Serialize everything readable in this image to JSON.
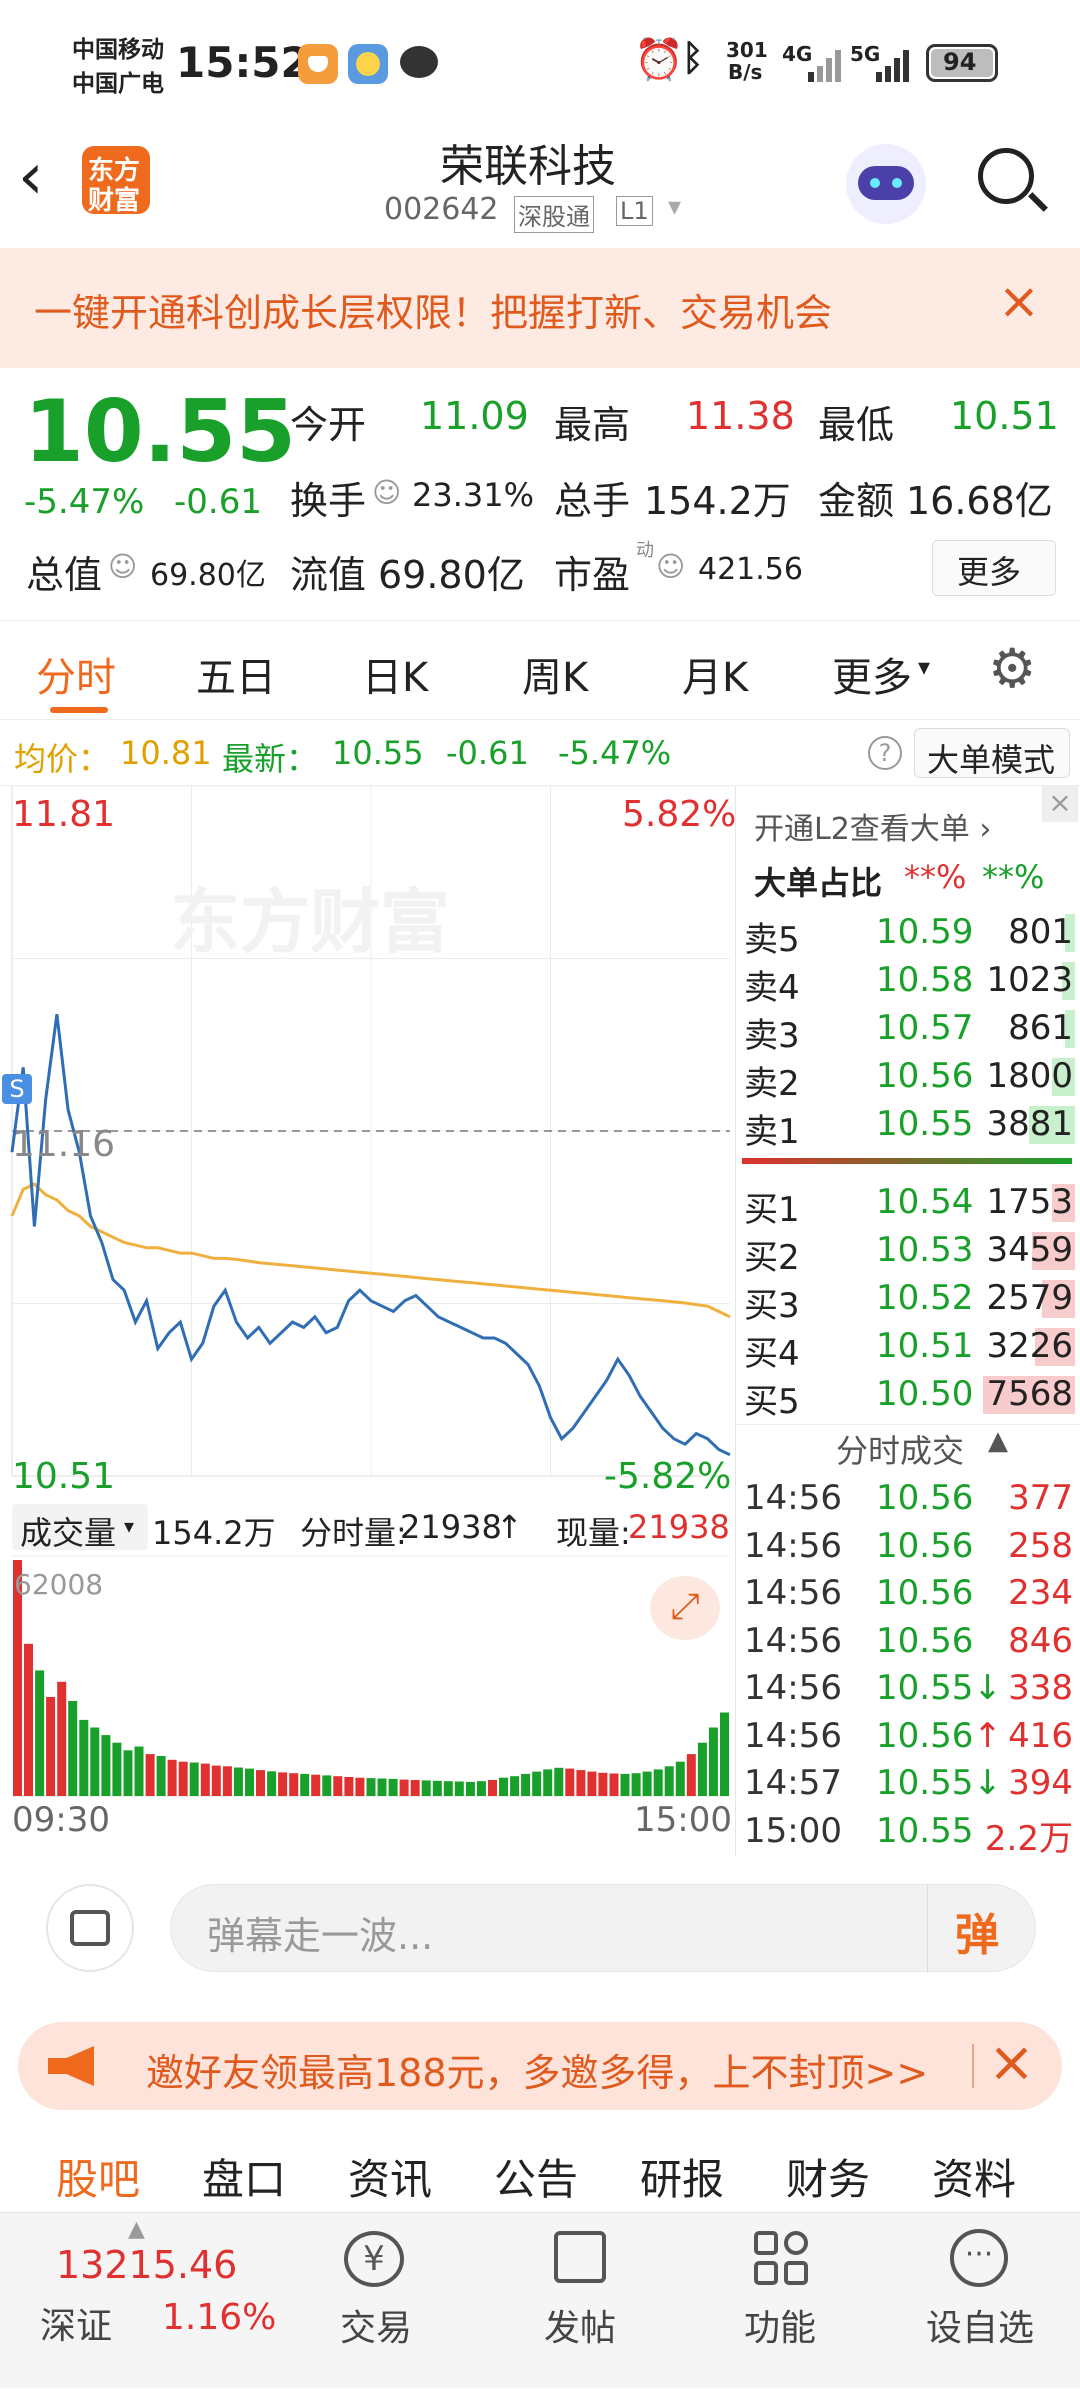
{
  "status": {
    "carrier1": "中国移动",
    "carrier2": "中国广电",
    "time": "15:52",
    "net_speed_top": "301",
    "net_speed_bot": "B/s",
    "net1": "4G",
    "net2": "5G",
    "battery": "94"
  },
  "nav": {
    "logo_top": "东方",
    "logo_bottom": "财富",
    "title": "荣联科技",
    "code": "002642",
    "tag1": "深股通",
    "tag2": "L1"
  },
  "banner": {
    "text": "一键开通科创成长层权限！把握打新、交易机会"
  },
  "quote": {
    "price": "10.55",
    "pct": "-5.47%",
    "chg": "-0.61",
    "open_label": "今开",
    "open": "11.09",
    "high_label": "最高",
    "high": "11.38",
    "low_label": "最低",
    "low": "10.51",
    "turnover_label": "换手",
    "turnover": "23.31%",
    "vol_label": "总手",
    "vol": "154.2万",
    "amt_label": "金额",
    "amt": "16.68亿",
    "mcap_label": "总值",
    "mcap": "69.80亿",
    "fmcap_label": "流值",
    "fmcap": "69.80亿",
    "pe_label": "市盈",
    "pe_sup": "动",
    "pe": "421.56",
    "more": "更多"
  },
  "tabs": [
    "分时",
    "五日",
    "日K",
    "周K",
    "月K",
    "更多"
  ],
  "info": {
    "avg_label": "均价：",
    "avg": "10.81",
    "last_label": "最新：",
    "last": "10.55",
    "chg": "-0.61",
    "pct": "-5.47%",
    "mode": "大单模式"
  },
  "chart": {
    "ymax": "11.81",
    "ymax_pct": "5.82%",
    "ymid": "11.16",
    "ymin": "10.51",
    "ymin_pct": "-5.82%",
    "badge": "S",
    "watermark": "东方财富",
    "vol_label": "成交量",
    "vol_total": "154.2万",
    "vol_min_label": "分时量:",
    "vol_min": "21938",
    "cur_label": "现量:",
    "cur": "21938",
    "vol_max": "62008",
    "t_start": "09:30",
    "t_end": "15:00"
  },
  "book": {
    "l2": "开通L2查看大单",
    "ratio_label": "大单占比",
    "ratio_red": "**%",
    "ratio_green": "**%",
    "asks": [
      {
        "label": "卖5",
        "price": "10.59",
        "vol": "801",
        "w": 0.03
      },
      {
        "label": "卖4",
        "price": "10.58",
        "vol": "1023",
        "w": 0.04
      },
      {
        "label": "卖3",
        "price": "10.57",
        "vol": "861",
        "w": 0.03
      },
      {
        "label": "卖2",
        "price": "10.56",
        "vol": "1800",
        "w": 0.07
      },
      {
        "label": "卖1",
        "price": "10.55",
        "vol": "3881",
        "w": 0.14
      }
    ],
    "bids": [
      {
        "label": "买1",
        "price": "10.54",
        "vol": "1753",
        "w": 0.07
      },
      {
        "label": "买2",
        "price": "10.53",
        "vol": "3459",
        "w": 0.13
      },
      {
        "label": "买3",
        "price": "10.52",
        "vol": "2579",
        "w": 0.1
      },
      {
        "label": "买4",
        "price": "10.51",
        "vol": "3226",
        "w": 0.12
      },
      {
        "label": "买5",
        "price": "10.50",
        "vol": "7568",
        "w": 0.28
      }
    ],
    "ticks_title": "分时成交",
    "ticks": [
      {
        "t": "14:56",
        "p": "10.56",
        "v": "377",
        "a": ""
      },
      {
        "t": "14:56",
        "p": "10.56",
        "v": "258",
        "a": ""
      },
      {
        "t": "14:56",
        "p": "10.56",
        "v": "234",
        "a": ""
      },
      {
        "t": "14:56",
        "p": "10.56",
        "v": "846",
        "a": ""
      },
      {
        "t": "14:56",
        "p": "10.55",
        "v": "338",
        "a": "↓"
      },
      {
        "t": "14:56",
        "p": "10.56",
        "v": "416",
        "a": "↑"
      },
      {
        "t": "14:57",
        "p": "10.55",
        "v": "394",
        "a": "↓"
      },
      {
        "t": "15:00",
        "p": "10.55",
        "v": "2.2万",
        "a": ""
      }
    ]
  },
  "comment": {
    "placeholder": "弹幕走一波...",
    "send": "弹"
  },
  "promo": {
    "text": "邀好友领最高188元，多邀多得，上不封顶>>"
  },
  "subtabs": [
    "股吧",
    "盘口",
    "资讯",
    "公告",
    "研报",
    "财务",
    "资料"
  ],
  "bottom": {
    "index_val": "13215.46",
    "index_name": "深证",
    "index_pct": "1.16%",
    "trade": "交易",
    "post": "发帖",
    "func": "功能",
    "fav": "设自选"
  },
  "colors": {
    "up": "#e03030",
    "down": "#18a02a",
    "accent": "#f06a1e",
    "avg_line": "#f0b040",
    "price_line": "#2f6db5"
  },
  "chart_data": {
    "type": "line",
    "title": "",
    "xlabel": "",
    "ylabel": "",
    "x_range": [
      "09:30",
      "15:00"
    ],
    "ylim": [
      10.51,
      11.81
    ],
    "prev_close": 11.16,
    "series": [
      {
        "values": [
          11.12,
          11.28,
          10.98,
          11.22,
          11.38,
          11.2,
          11.12,
          11.0,
          10.95,
          10.88,
          10.86,
          10.8,
          10.84,
          10.75,
          10.78,
          10.8,
          10.73,
          10.76,
          10.83,
          10.86,
          10.8,
          10.77,
          10.79,
          10.76,
          10.78,
          10.8,
          10.79,
          10.81,
          10.78,
          10.79,
          10.84,
          10.86,
          10.84,
          10.83,
          10.82,
          10.84,
          10.85,
          10.83,
          10.81,
          10.8,
          10.79,
          10.78,
          10.77,
          10.77,
          10.76,
          10.74,
          10.72,
          10.68,
          10.62,
          10.58,
          10.6,
          10.63,
          10.66,
          10.69,
          10.73,
          10.7,
          10.66,
          10.63,
          10.6,
          10.58,
          10.57,
          10.59,
          10.58,
          10.56,
          10.55
        ]
      },
      {
        "values": [
          11.0,
          11.05,
          11.06,
          11.04,
          11.03,
          11.01,
          11.0,
          10.98,
          10.97,
          10.96,
          10.95,
          10.945,
          10.94,
          10.94,
          10.935,
          10.93,
          10.93,
          10.925,
          10.92,
          10.92,
          10.918,
          10.915,
          10.912,
          10.91,
          10.908,
          10.906,
          10.904,
          10.902,
          10.9,
          10.898,
          10.896,
          10.894,
          10.892,
          10.89,
          10.888,
          10.886,
          10.884,
          10.882,
          10.88,
          10.878,
          10.876,
          10.874,
          10.872,
          10.87,
          10.868,
          10.866,
          10.864,
          10.862,
          10.86,
          10.858,
          10.856,
          10.854,
          10.852,
          10.85,
          10.848,
          10.846,
          10.844,
          10.842,
          10.84,
          10.838,
          10.836,
          10.833,
          10.83,
          10.82,
          10.81
        ]
      }
    ],
    "volume": [
      62008,
      40000,
      33000,
      26000,
      30000,
      25000,
      20000,
      18000,
      16000,
      14000,
      12000,
      13000,
      11000,
      10500,
      9500,
      9000,
      8800,
      8500,
      8000,
      7800,
      7500,
      7200,
      6800,
      6500,
      6200,
      6000,
      5800,
      5600,
      5400,
      5200,
      5000,
      4800,
      4700,
      4600,
      4500,
      4300,
      4200,
      4100,
      4000,
      3900,
      3800,
      3700,
      3900,
      4200,
      4800,
      5200,
      5800,
      6400,
      7000,
      7400,
      7200,
      6800,
      6400,
      6100,
      5900,
      5800,
      6000,
      6400,
      7000,
      7800,
      9000,
      11000,
      14000,
      18000,
      21938
    ]
  }
}
